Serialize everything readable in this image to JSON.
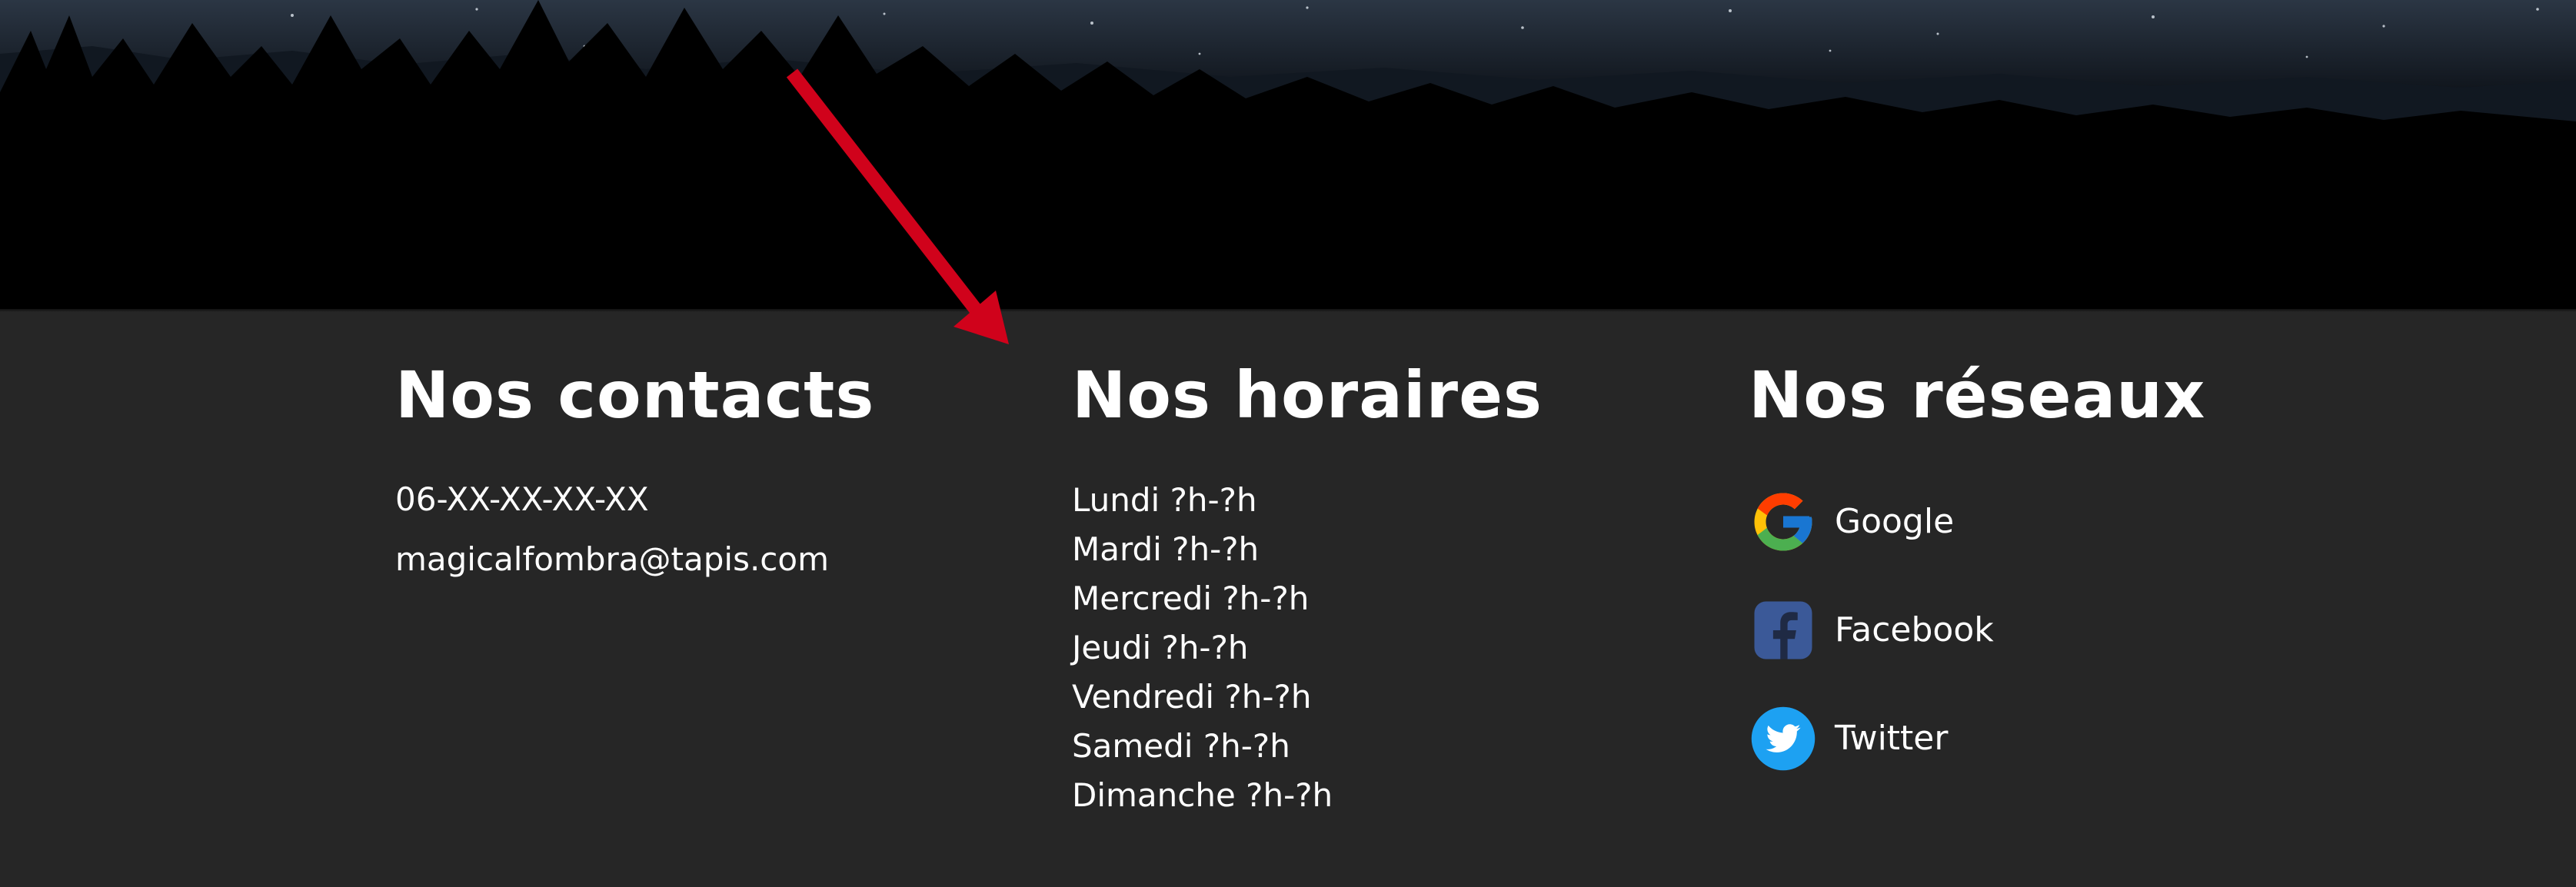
{
  "footer": {
    "background": "#262626",
    "contacts": {
      "title": "Nos contacts",
      "phone": "06-XX-XX-XX-XX",
      "email": "magicalfombra@tapis.com"
    },
    "hours": {
      "title": "Nos horaires",
      "days": [
        "Lundi ?h-?h",
        "Mardi ?h-?h",
        "Mercredi ?h-?h",
        "Jeudi ?h-?h",
        "Vendredi ?h-?h",
        "Samedi ?h-?h",
        "Dimanche ?h-?h"
      ]
    },
    "social": {
      "title": "Nos réseaux",
      "links": [
        {
          "label": "Google",
          "icon": "google-icon"
        },
        {
          "label": "Facebook",
          "icon": "facebook-icon"
        },
        {
          "label": "Twitter",
          "icon": "twitter-icon"
        }
      ]
    }
  },
  "annotation": {
    "type": "arrow",
    "color": "#d0021b"
  },
  "colors": {
    "text": "#ffffff",
    "google_blue": "#4285F4",
    "google_red": "#EA4335",
    "google_yellow": "#FBBC05",
    "google_green": "#34A853",
    "facebook_blue": "#3B5998",
    "twitter_blue": "#1DA1F2"
  }
}
